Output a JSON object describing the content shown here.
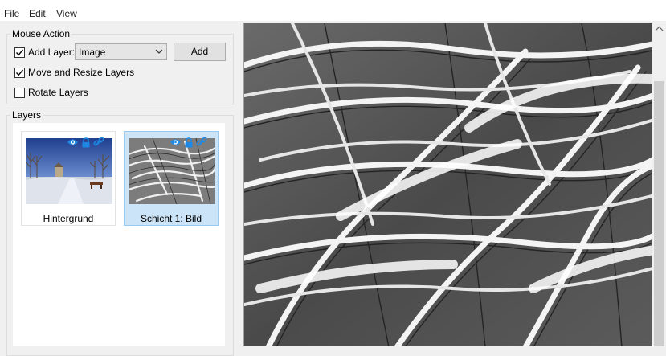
{
  "menu": {
    "file": "File",
    "edit": "Edit",
    "view": "View"
  },
  "mouse_action": {
    "title": "Mouse Action",
    "add_layer_label": "Add Layer:",
    "add_layer_checked": true,
    "layer_type_value": "Image",
    "add_button": "Add",
    "move_resize_label": "Move and Resize Layers",
    "move_resize_checked": true,
    "rotate_label": "Rotate Layers",
    "rotate_checked": false
  },
  "layers": {
    "title": "Layers",
    "items": [
      {
        "label": "Hintergrund",
        "selected": false
      },
      {
        "label": "Schicht 1: Bild",
        "selected": true
      }
    ]
  },
  "icons": [
    "eye-icon",
    "lock-icon",
    "link-icon",
    "chevron-down-icon",
    "checkmark-icon"
  ],
  "colors": {
    "selection_bg": "#cce4f7",
    "selection_border": "#99c9ef",
    "layer_icon": "#1e88e5"
  }
}
